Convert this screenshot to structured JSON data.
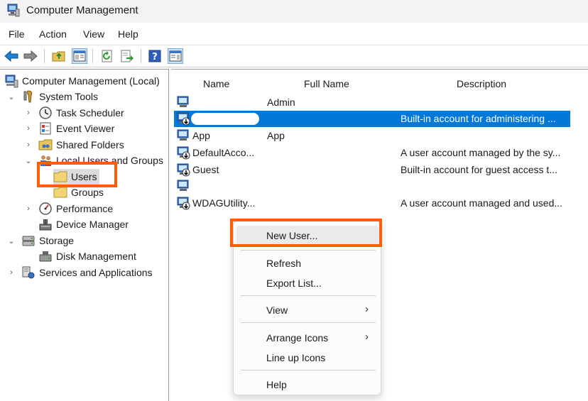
{
  "window": {
    "title": "Computer Management"
  },
  "menu": [
    "File",
    "Action",
    "View",
    "Help"
  ],
  "toolbar": [
    "back-icon",
    "forward-icon",
    "up-folder-icon",
    "show-hide-tree-icon",
    "refresh-icon",
    "export-list-icon",
    "help-icon",
    "action-pane-icon"
  ],
  "tree": {
    "root": "Computer Management (Local)",
    "system_tools": "System Tools",
    "task_scheduler": "Task Scheduler",
    "event_viewer": "Event Viewer",
    "shared_folders": "Shared Folders",
    "local_users_groups": "Local Users and Groups",
    "users": "Users",
    "groups": "Groups",
    "performance": "Performance",
    "device_manager": "Device Manager",
    "storage": "Storage",
    "disk_management": "Disk Management",
    "services_apps": "Services and Applications"
  },
  "list": {
    "headers": {
      "name": "Name",
      "full_name": "Full Name",
      "description": "Description"
    },
    "rows": [
      {
        "name": "",
        "full_name": "Admin",
        "description": ""
      },
      {
        "name": "",
        "full_name": "",
        "description": "Built-in account for administering ..."
      },
      {
        "name": "App",
        "full_name": "App",
        "description": ""
      },
      {
        "name": "DefaultAcco...",
        "full_name": "",
        "description": "A user account managed by the sy..."
      },
      {
        "name": "Guest",
        "full_name": "",
        "description": "Built-in account for guest access t..."
      },
      {
        "name": "",
        "full_name": "",
        "description": ""
      },
      {
        "name": "WDAGUtility...",
        "full_name": "",
        "description": "A user account managed and used..."
      }
    ]
  },
  "context_menu": {
    "new_user": "New User...",
    "refresh": "Refresh",
    "export_list": "Export List...",
    "view": "View",
    "arrange_icons": "Arrange Icons",
    "line_up_icons": "Line up Icons",
    "help": "Help",
    "submenu_arrow": "›"
  },
  "colors": {
    "selection": "#0078d7",
    "highlight": "#ff5f00"
  }
}
